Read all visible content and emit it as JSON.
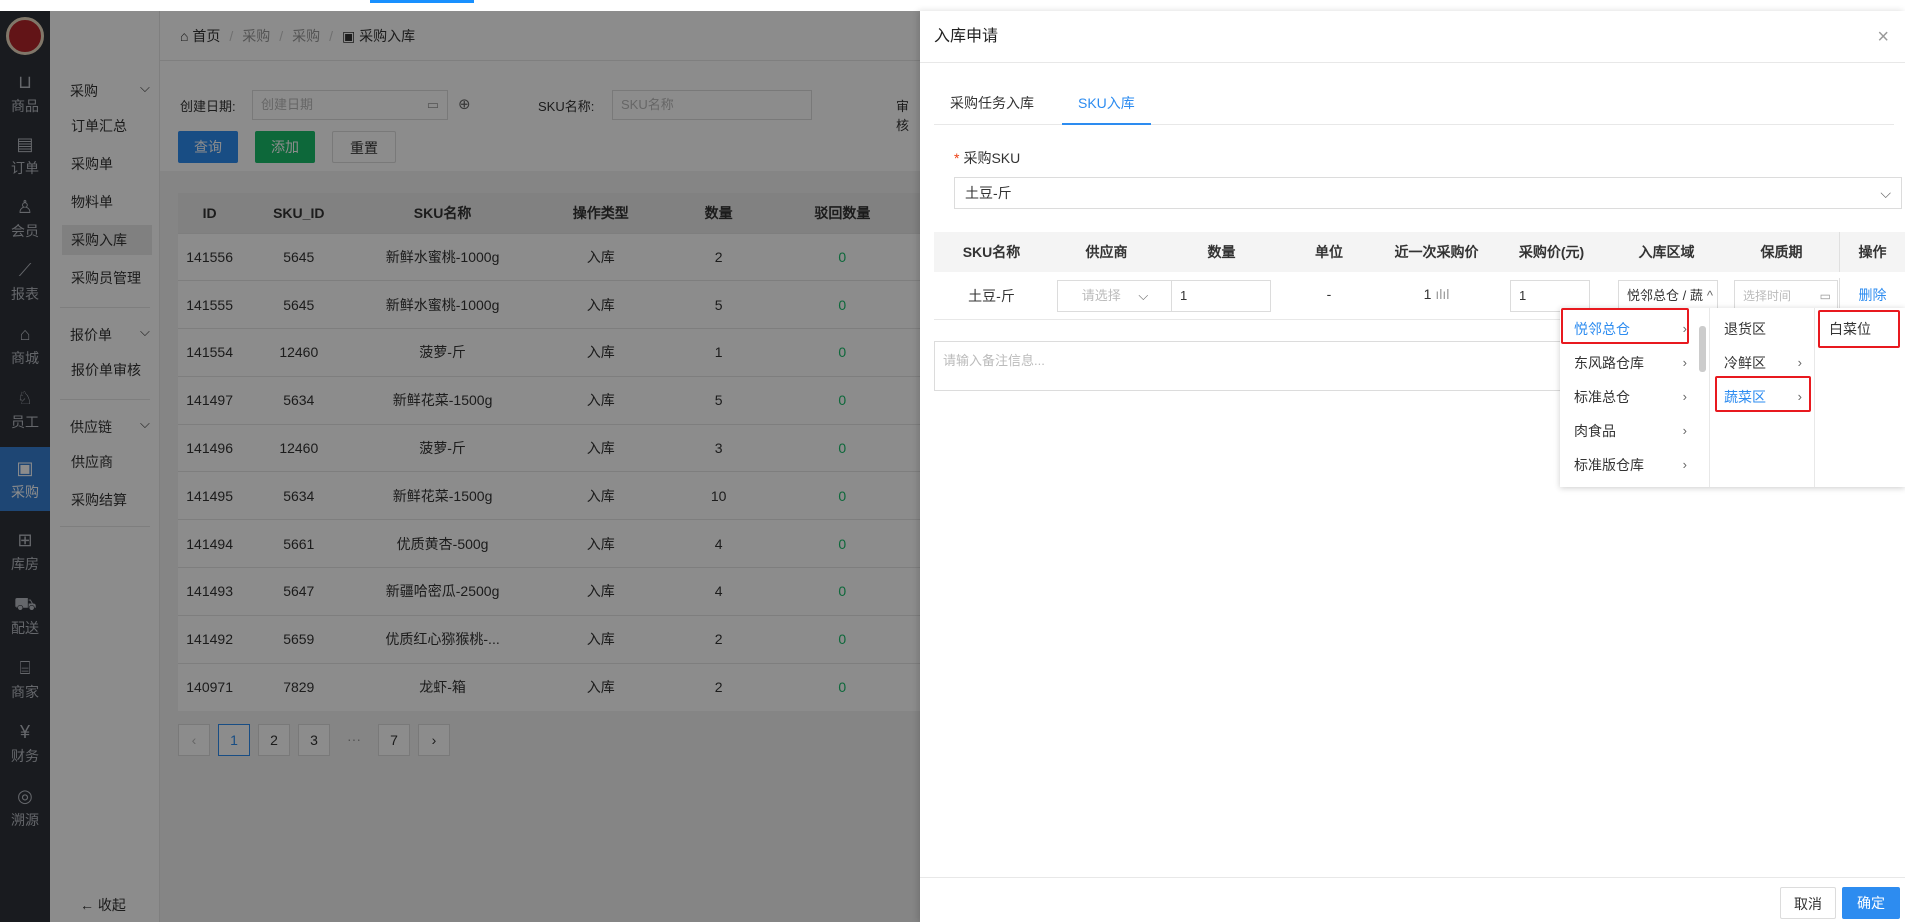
{
  "sidebar": {
    "items": [
      {
        "label": "商品",
        "icon": "bag-icon"
      },
      {
        "label": "订单",
        "icon": "document-icon"
      },
      {
        "label": "会员",
        "icon": "user-icon"
      },
      {
        "label": "报表",
        "icon": "chart-icon"
      },
      {
        "label": "商城",
        "icon": "home-icon"
      },
      {
        "label": "员工",
        "icon": "staff-icon"
      },
      {
        "label": "采购",
        "icon": "clipboard-icon"
      },
      {
        "label": "库房",
        "icon": "grid-icon"
      },
      {
        "label": "配送",
        "icon": "truck-icon"
      },
      {
        "label": "商家",
        "icon": "shop-icon"
      },
      {
        "label": "财务",
        "icon": "yen-icon"
      },
      {
        "label": "溯源",
        "icon": "target-icon"
      }
    ]
  },
  "submenu": {
    "group1": "采购",
    "items1": [
      "订单汇总",
      "采购单",
      "物料单",
      "采购入库",
      "采购员管理"
    ],
    "group2": "报价单",
    "items2": [
      "报价单审核"
    ],
    "group3": "供应链",
    "items3": [
      "供应商",
      "采购结算"
    ],
    "collapse": "收起"
  },
  "breadcrumb": {
    "home": "首页",
    "c1": "采购",
    "c2": "采购",
    "current": "采购入库"
  },
  "filter": {
    "date_label": "创建日期:",
    "date_placeholder": "创建日期",
    "sku_label": "SKU名称:",
    "sku_placeholder": "SKU名称",
    "audit_label": "审核",
    "query": "查询",
    "add": "添加",
    "reset": "重置"
  },
  "table": {
    "headers": [
      "ID",
      "SKU_ID",
      "SKU名称",
      "操作类型",
      "数量",
      "驳回数量"
    ],
    "rows": [
      [
        "141556",
        "5645",
        "新鲜水蜜桃-1000g",
        "入库",
        "2",
        "0"
      ],
      [
        "141555",
        "5645",
        "新鲜水蜜桃-1000g",
        "入库",
        "5",
        "0"
      ],
      [
        "141554",
        "12460",
        "菠萝-斤",
        "入库",
        "1",
        "0"
      ],
      [
        "141497",
        "5634",
        "新鲜花菜-1500g",
        "入库",
        "5",
        "0"
      ],
      [
        "141496",
        "12460",
        "菠萝-斤",
        "入库",
        "3",
        "0"
      ],
      [
        "141495",
        "5634",
        "新鲜花菜-1500g",
        "入库",
        "10",
        "0"
      ],
      [
        "141494",
        "5661",
        "优质黄杏-500g",
        "入库",
        "4",
        "0"
      ],
      [
        "141493",
        "5647",
        "新疆哈密瓜-2500g",
        "入库",
        "4",
        "0"
      ],
      [
        "141492",
        "5659",
        "优质红心猕猴桃-...",
        "入库",
        "2",
        "0"
      ],
      [
        "140971",
        "7829",
        "龙虾-箱",
        "入库",
        "2",
        "0"
      ]
    ]
  },
  "pager": {
    "prev": "‹",
    "pages": [
      "1",
      "2",
      "3",
      "···",
      "7"
    ],
    "next": "›",
    "current": "1"
  },
  "drawer": {
    "title": "入库申请",
    "tabs": [
      "采购任务入库",
      "SKU入库"
    ],
    "active_tab": "SKU入库",
    "sku_label": "采购SKU",
    "sku_value": "土豆-斤",
    "columns": [
      "SKU名称",
      "供应商",
      "数量",
      "单位",
      "近一次采购价",
      "采购价(元)",
      "入库区域",
      "保质期",
      "操作"
    ],
    "row": {
      "name": "土豆-斤",
      "supplier_placeholder": "请选择",
      "qty": "1",
      "unit": "-",
      "last_price": "1",
      "price": "1",
      "area": "悦邻总仓 / 蔬",
      "expiry_placeholder": "选择时间",
      "action": "删除"
    },
    "remark_placeholder": "请输入备注信息...",
    "cancel": "取消",
    "confirm": "确定"
  },
  "cascader": {
    "col1": [
      "悦邻总仓",
      "东风路仓库",
      "标准总仓",
      "肉食品",
      "标准版仓库"
    ],
    "col2": [
      "退货区",
      "冷鲜区",
      "蔬菜区"
    ],
    "col3": [
      "白菜位"
    ],
    "selected": [
      "悦邻总仓",
      "蔬菜区",
      "白菜位"
    ]
  },
  "colors": {
    "accent": "#2d8cf0",
    "success": "#19be6b",
    "highlight": "#e8191f",
    "sidebar": "#2e323a"
  }
}
